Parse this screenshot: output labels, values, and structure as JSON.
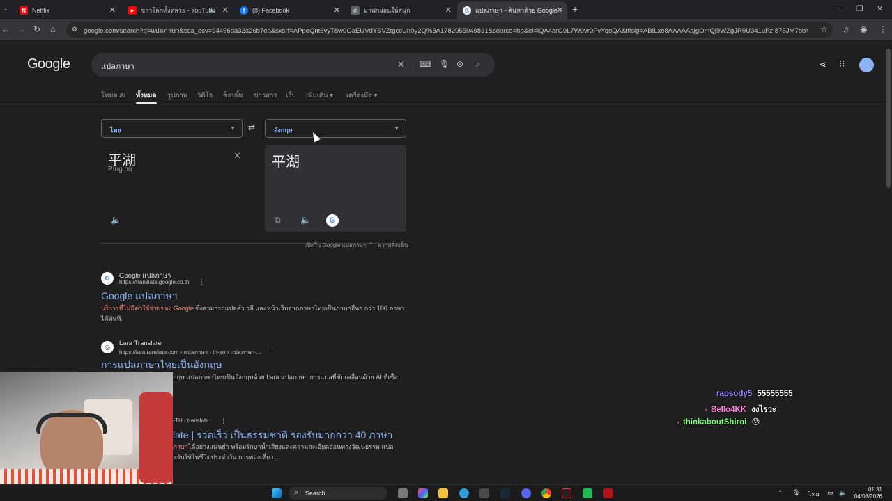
{
  "browser": {
    "tabs": [
      {
        "title": "Netflix",
        "favicon_color": "#e50914",
        "favicon_text": "N"
      },
      {
        "title": "ชาวโลกทั้งหลาย - YouTube",
        "favicon_color": "#ff0000",
        "favicon_text": "▶"
      },
      {
        "title": "(8) Facebook",
        "favicon_color": "#1877f2",
        "favicon_text": "f"
      },
      {
        "title": "มาพักผ่อนให้สนุก",
        "favicon_color": "#5f6368",
        "favicon_text": "◎"
      },
      {
        "title": "แปลภาษา - ค้นหาด้วย Google",
        "favicon_color": "#ffffff",
        "favicon_text": "G"
      }
    ],
    "url": "google.com/search?q=แปลภาษา&sca_esv=94496da32a26b7ea&sxsrf=APpeQnt6vyT8w0GaEUVdYBVZtgccUn0y2Q%3A1782055049831&source=hp&ei=iQA4arG9L7W9vr0PvYqoQA&iflsig=ABILxe8AAAAAajgOmQj9WZgJR9U341uFz-875JM7bbY0&oq=แป..."
  },
  "google": {
    "logo": "Google",
    "query": "แปลภาษา",
    "nav_tabs": [
      "โหมด AI",
      "ทั้งหมด",
      "รูปภาพ",
      "วิดีโอ",
      "ช็อปปิ้ง",
      "ข่าวสาร",
      "เว็บ",
      "เพิ่มเติม",
      "เครื่องมือ"
    ]
  },
  "translate": {
    "source_lang": "ไทย",
    "target_lang": "อังกฤษ",
    "source_text": "平湖",
    "source_romanization": "Píng hú",
    "target_text": "平湖",
    "open_in_translate": "เปิดใน Google แปลภาษา",
    "feedback": "ความคิดเห็น"
  },
  "results": [
    {
      "site": "Google แปลภาษา",
      "url": "https://translate.google.co.th",
      "title": "Google แปลภาษา",
      "desc_highlight": "บริการที่ไม่มีค่าใช้จ่ายของ Google",
      "desc": " ซึ่งสามารถแปลคำ วลี และหน้าเว็บจากภาษาไทยเป็นภาษาอื่นๆ กว่า 100 ภาษา ได้ทันที."
    },
    {
      "site": "Lara Translate",
      "url": "https://laratranslate.com › แปลภาษา › th-en › แปลภาษา-...",
      "title": "การแปลภาษาไทยเป็นอังกฤษ",
      "desc_highlight": "",
      "desc": "กฤษ แปลภาษาไทยเป็นอังกฤษด้วย Lara แปลภาษา การแปลที่ขับเคลื่อนด้วย AI ที่เชื่อ"
    },
    {
      "site": "",
      "url": "n-TH › translate",
      "title": "late | รวดเร็ว เป็นธรรมชาติ รองรับมากกว่า 40 ภาษา",
      "desc_highlight": "ภาษา",
      "desc": "ได้อย่างแม่นยำ พร้อมรักษาน้ำเสียงและความละเอียดอ่อนทางวัฒนธรรม แปล",
      "desc2": "หรับใช้ในชีวิตประจำวัน การท่องเที่ยว ..."
    }
  ],
  "chat": [
    {
      "user": "rapsody5",
      "user_color": "#9b8cff",
      "msg": "55555555"
    },
    {
      "user": "Bello4KK",
      "user_color": "#ff7ad9",
      "msg": "งงไรวะ"
    },
    {
      "user": "thinkaboutShiroi",
      "user_color": "#7dff7a",
      "msg": "😯"
    }
  ],
  "taskbar": {
    "search": "Search",
    "lang": "ไทย",
    "time": "01:31",
    "date": "04/08/2026"
  }
}
